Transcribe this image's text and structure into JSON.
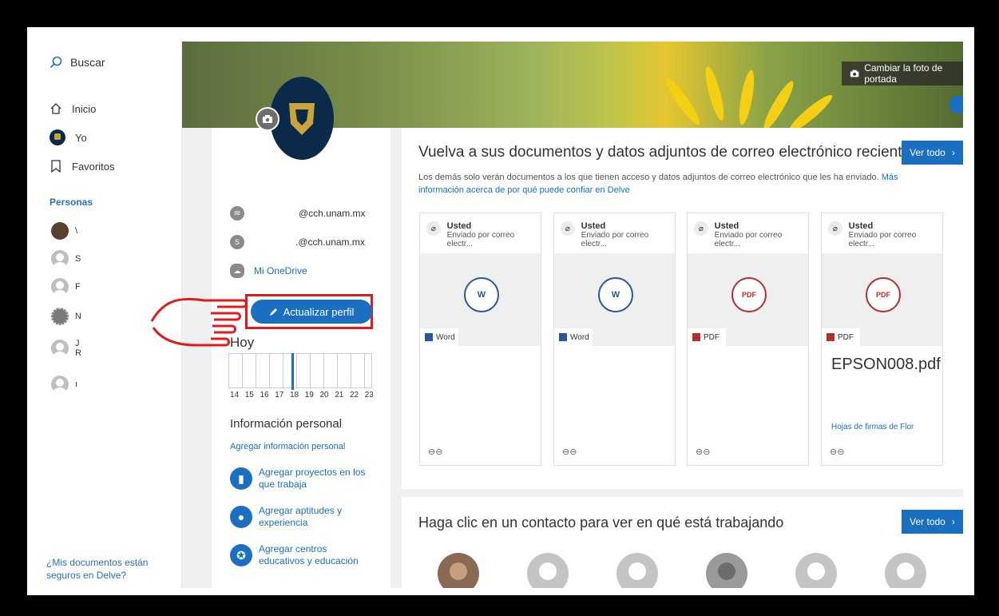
{
  "sidebar": {
    "search_label": "Buscar",
    "items": [
      {
        "label": "Inicio",
        "icon": "home-icon"
      },
      {
        "label": "Yo",
        "icon": "avatar"
      },
      {
        "label": "Favoritos",
        "icon": "bookmark-icon"
      }
    ],
    "people_heading": "Personas",
    "people": [
      "\\",
      "S",
      "F",
      "N",
      "J\nR",
      "ı"
    ],
    "footer_link": "¿Mis documentos están seguros en Delve?"
  },
  "banner": {
    "change_cover_label": "Cambiar la foto de portada"
  },
  "profile": {
    "email_1": "@cch.unam.mx",
    "email_2": ".@cch.unam.mx",
    "onedrive_label": "Mi OneDrive",
    "update_profile_label": "Actualizar perfil",
    "today_label": "Hoy",
    "timeline_hours": [
      "14",
      "15",
      "16",
      "17",
      "18",
      "19",
      "20",
      "21",
      "22",
      "23"
    ],
    "personal_info_title": "Información personal",
    "add_personal_info": "Agregar información personal",
    "add_projects": "Agregar proyectos en los que trabaja",
    "add_skills": "Agregar aptitudes y experiencia",
    "add_education": "Agregar centros educativos y educación"
  },
  "documents": {
    "title": "Vuelva a sus documentos y datos adjuntos de correo electrónico recientes",
    "view_all_label": "Ver todo",
    "description": "Los demás solo verán documentos a los que tienen acceso y datos adjuntos de correo electrónico que les ha enviado.",
    "more_info_link": "Más información acerca de por qué puede confiar en Delve",
    "cards": [
      {
        "user": "Usted",
        "sent": "Enviado por correo electr...",
        "type": "Word",
        "name": "",
        "meta": ""
      },
      {
        "user": "Usted",
        "sent": "Enviado por correo electr...",
        "type": "Word",
        "name": "",
        "meta": ""
      },
      {
        "user": "Usted",
        "sent": "Enviado por correo electr...",
        "type": "PDF",
        "name": "",
        "meta": ""
      },
      {
        "user": "Usted",
        "sent": "Enviado por correo electr...",
        "type": "PDF",
        "name": "EPSON008.pdf",
        "meta": "Hojas de firmas de Flor"
      }
    ]
  },
  "contacts": {
    "title": "Haga clic en un contacto para ver en qué está trabajando",
    "view_all_label": "Ver todo"
  },
  "colors": {
    "accent": "#1a6fc1",
    "highlight": "#e01b1b",
    "word": "#2b579a",
    "pdf": "#b52f2f"
  }
}
